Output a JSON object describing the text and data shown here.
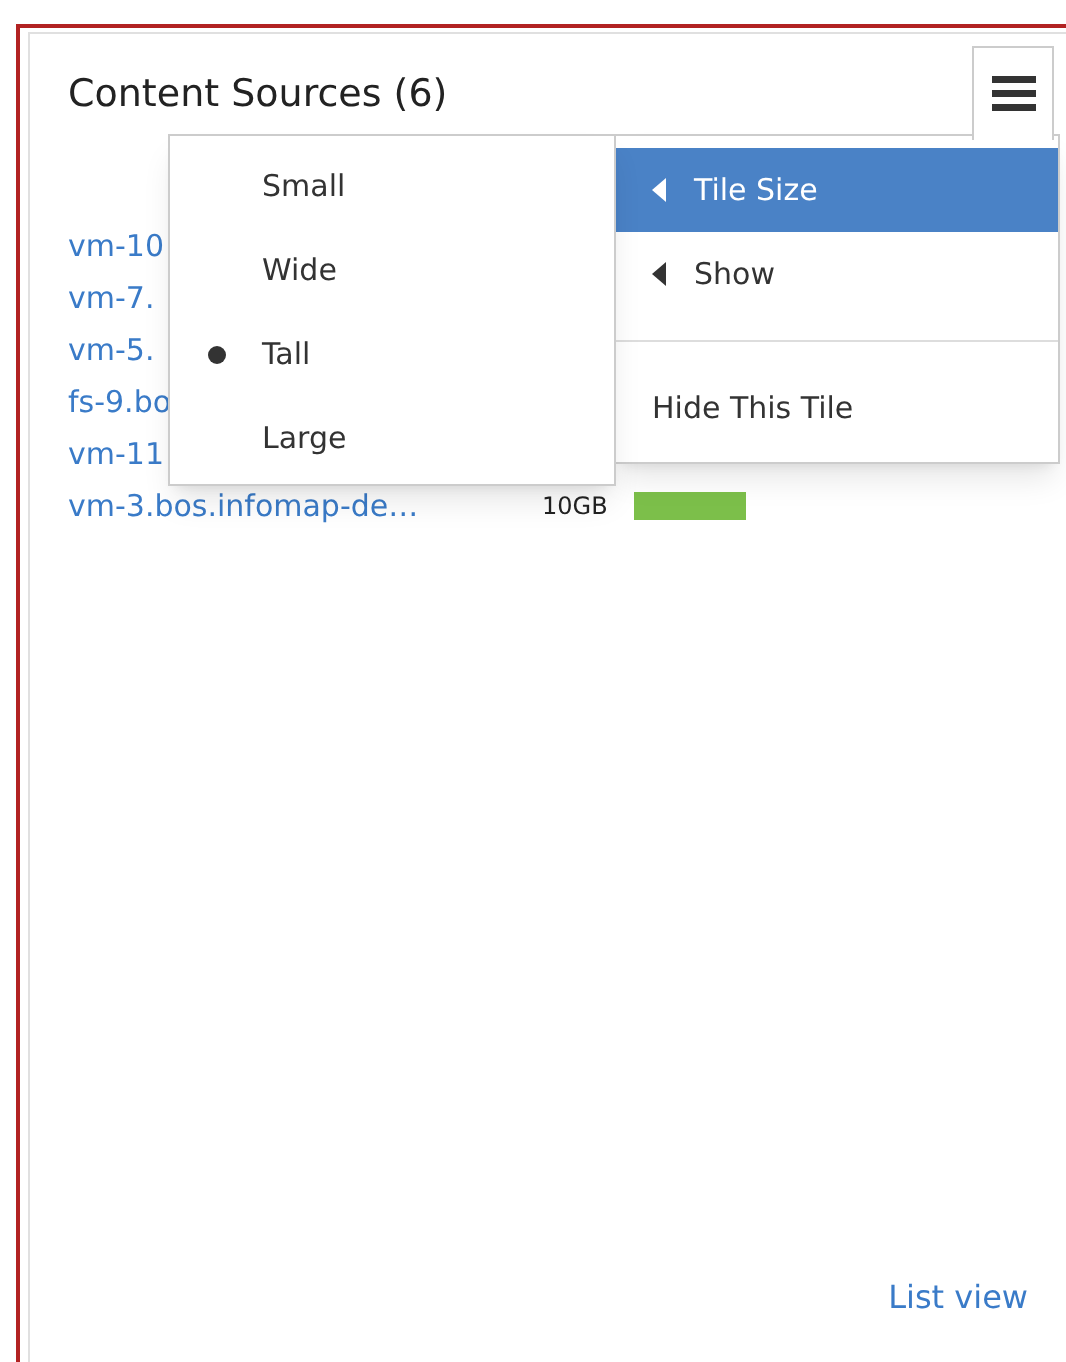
{
  "tile": {
    "title": "Content Sources (6)",
    "footer_link": "List view"
  },
  "sources": [
    {
      "name": "vm-10"
    },
    {
      "name": "vm-7."
    },
    {
      "name": "vm-5."
    },
    {
      "name": "fs-9.bo"
    },
    {
      "name": "vm-11"
    },
    {
      "name": "vm-3.bos.infomap-de…",
      "size": "10GB"
    }
  ],
  "menu": {
    "open": true,
    "items": [
      {
        "label": "Tile Size",
        "kind": "submenu",
        "selected": true
      },
      {
        "label": "Show",
        "kind": "submenu",
        "selected": false
      },
      {
        "label": "Hide This Tile",
        "kind": "action",
        "selected": false
      }
    ]
  },
  "size_submenu": [
    {
      "label": "Small",
      "selected": false
    },
    {
      "label": "Wide",
      "selected": false
    },
    {
      "label": "Tall",
      "selected": true
    },
    {
      "label": "Large",
      "selected": false
    }
  ]
}
